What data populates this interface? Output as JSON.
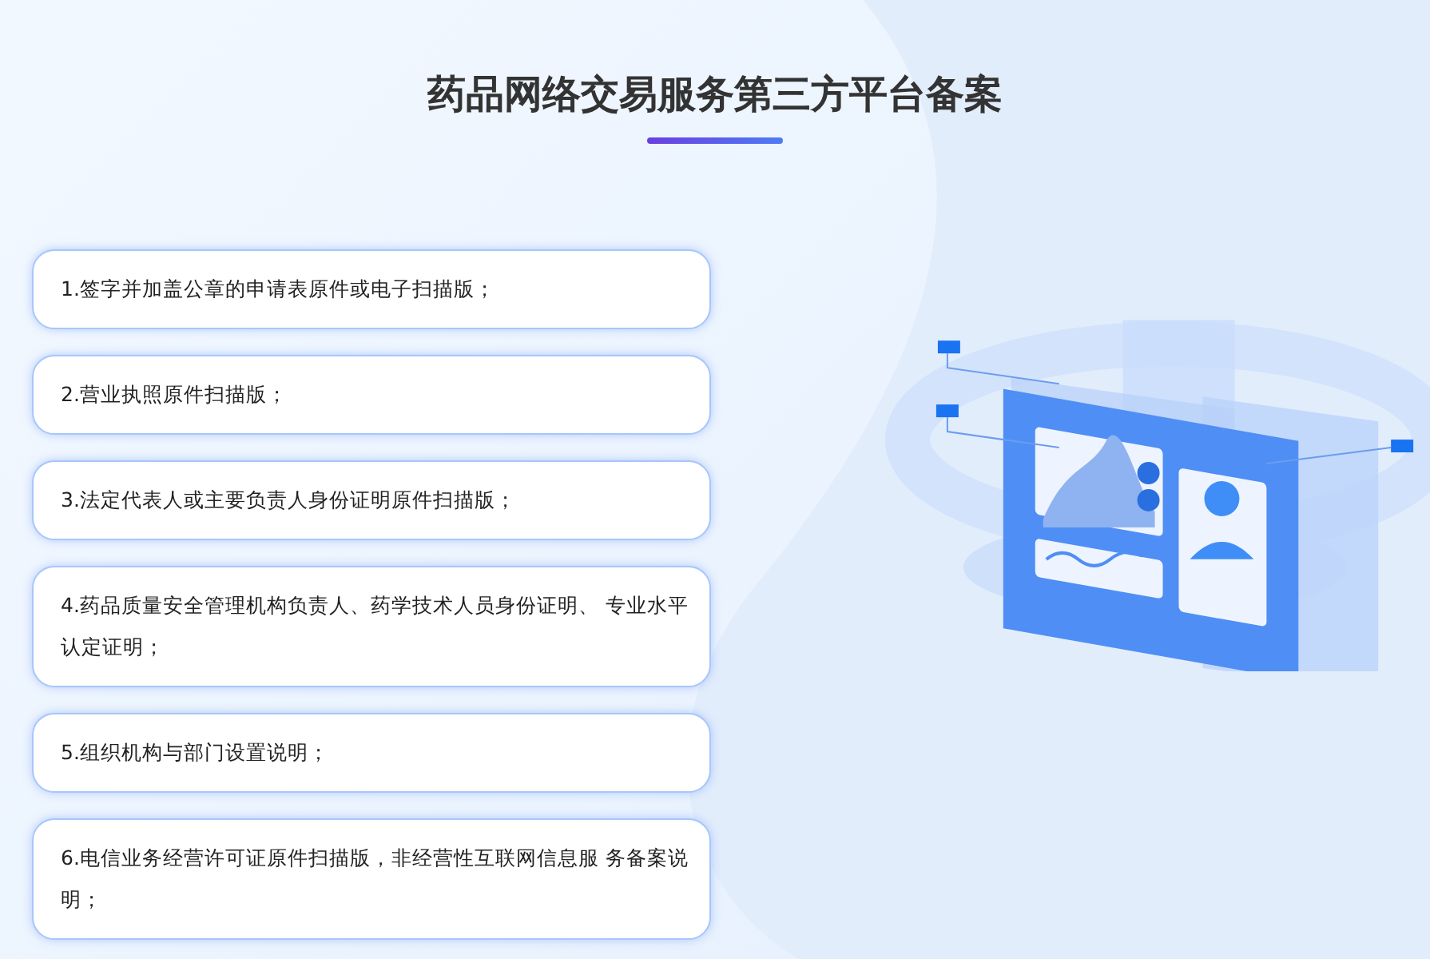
{
  "title": "药品网络交易服务第三方平台备案",
  "requirements": [
    {
      "text": "1.签字并加盖公章的申请表原件或电子扫描版；"
    },
    {
      "text": "2.营业执照原件扫描版；"
    },
    {
      "text": "3.法定代表人或主要负责人身份证明原件扫描版；"
    },
    {
      "text": "4.药品质量安全管理机构负责人、药学技术人员身份证明、 专业水平认定证明；"
    },
    {
      "text": "5.组织机构与部门设置说明；"
    },
    {
      "text": "6.电信业务经营许可证原件扫描版，非经营性互联网信息服 务备案说明；"
    }
  ]
}
